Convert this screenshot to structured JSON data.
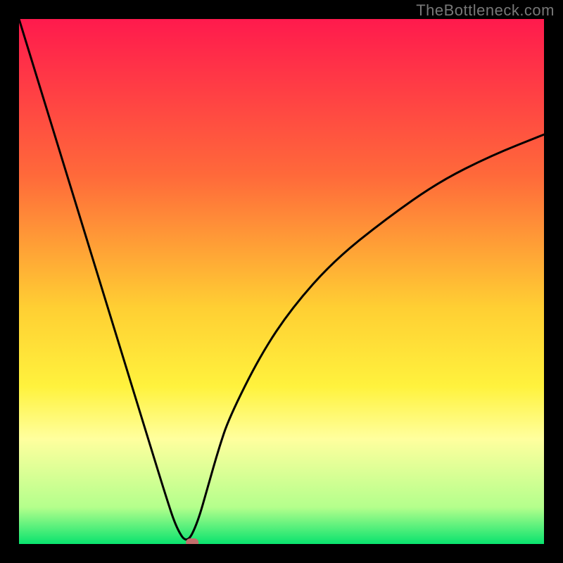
{
  "attribution": "TheBottleneck.com",
  "colors": {
    "frame": "#000000",
    "attribution_text": "#777777",
    "curve": "#000000",
    "marker": "#c26e6c",
    "gradient_stops": [
      {
        "offset": 0.0,
        "color": "#ff1a4d"
      },
      {
        "offset": 0.3,
        "color": "#ff6a3a"
      },
      {
        "offset": 0.55,
        "color": "#ffcf33"
      },
      {
        "offset": 0.7,
        "color": "#fff23d"
      },
      {
        "offset": 0.8,
        "color": "#ffff9e"
      },
      {
        "offset": 0.93,
        "color": "#b4ff8c"
      },
      {
        "offset": 1.0,
        "color": "#09e36e"
      }
    ]
  },
  "chart_data": {
    "type": "line",
    "x": [
      0.0,
      0.04,
      0.08,
      0.12,
      0.16,
      0.2,
      0.24,
      0.28,
      0.3,
      0.32,
      0.34,
      0.36,
      0.38,
      0.4,
      0.46,
      0.52,
      0.6,
      0.7,
      0.8,
      0.9,
      1.0
    ],
    "values": [
      100,
      87,
      74,
      61,
      48,
      35,
      22,
      9,
      3,
      0,
      4,
      11,
      18,
      24,
      36,
      45,
      54,
      62,
      69,
      74,
      78
    ],
    "title": "",
    "xlabel": "",
    "ylabel": "",
    "ylim": [
      0,
      100
    ],
    "xlim": [
      0,
      1
    ],
    "marker": {
      "x": 0.33,
      "y": 0
    }
  }
}
